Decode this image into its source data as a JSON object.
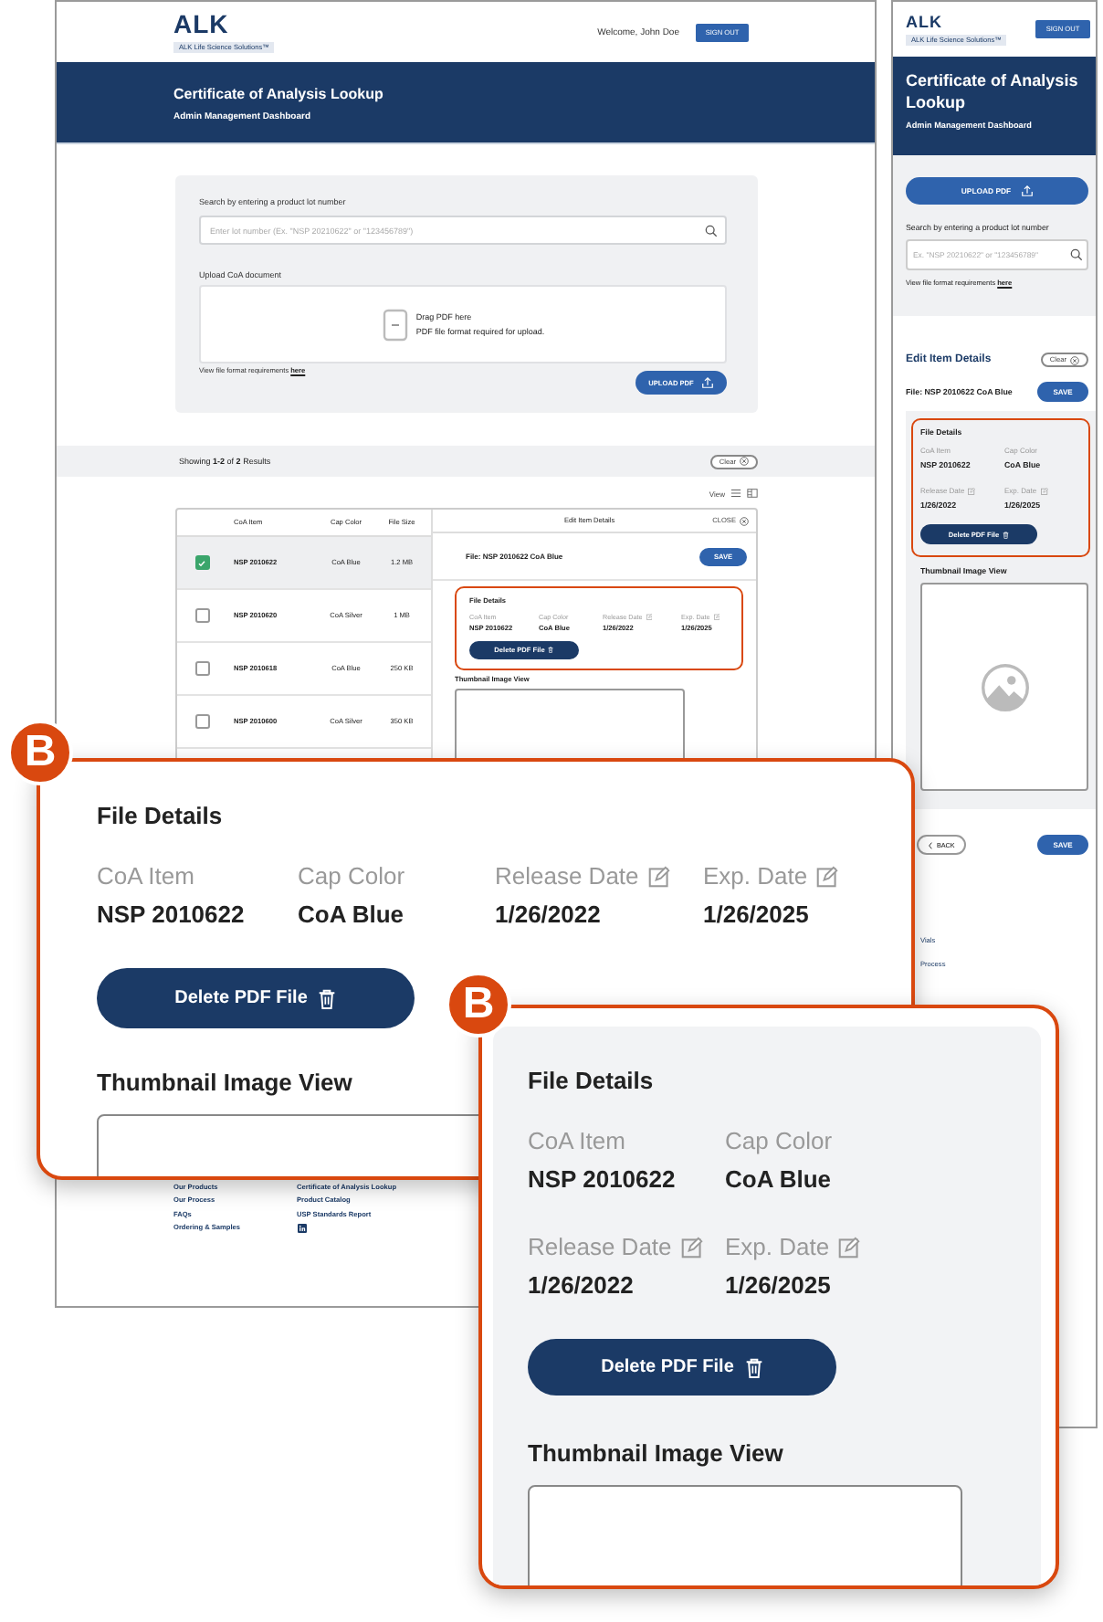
{
  "desktop": {
    "header": {
      "logo": "ALK",
      "tagline": "ALK Life Science Solutions™",
      "welcome": "Welcome, John Doe",
      "sign_out": "SIGN OUT"
    },
    "banner": {
      "title": "Certificate of Analysis Lookup",
      "subtitle": "Admin Management Dashboard"
    },
    "search": {
      "label": "Search by entering a product lot number",
      "placeholder": "Enter lot number (Ex. \"NSP 20210622\" or \"123456789\")"
    },
    "upload": {
      "label": "Upload CoA document",
      "drop_title": "Drag PDF here",
      "drop_hint": "PDF file format required for upload.",
      "requirements": "View file format requirements",
      "requirements_link": "here",
      "button": "UPLOAD PDF"
    },
    "results": {
      "summary": "Showing **1-2** of **2** Results",
      "clear": "Clear"
    },
    "view": {
      "label": "View"
    },
    "table": {
      "columns": [
        "CoA Item",
        "Cap Color",
        "File Size"
      ],
      "rows": [
        {
          "item": "NSP 2010622",
          "cap_color": "CoA Blue",
          "size": "1.2 MB",
          "checked": true,
          "selected": true
        },
        {
          "item": "NSP 2010620",
          "cap_color": "CoA Silver",
          "size": "1 MB",
          "checked": false,
          "selected": false
        },
        {
          "item": "NSP 2010618",
          "cap_color": "CoA Blue",
          "size": "250 KB",
          "checked": false,
          "selected": false
        },
        {
          "item": "NSP 2010600",
          "cap_color": "CoA Silver",
          "size": "350 KB",
          "checked": false,
          "selected": false
        }
      ]
    },
    "editor": {
      "title": "Edit Item Details",
      "close": "CLOSE",
      "file": "File: NSP 2010622 CoA Blue",
      "save": "SAVE",
      "details": {
        "title": "File Details",
        "fields": [
          {
            "label": "CoA Item",
            "value": "NSP 2010622",
            "editable": false
          },
          {
            "label": "Cap Color",
            "value": "CoA Blue",
            "editable": false
          },
          {
            "label": "Release Date",
            "value": "1/26/2022",
            "editable": true
          },
          {
            "label": "Exp. Date",
            "value": "1/26/2025",
            "editable": true
          }
        ],
        "delete": "Delete PDF File"
      },
      "thumbnail_label": "Thumbnail Image View"
    },
    "footer": {
      "columns": [
        [
          "Our Products",
          "Our Process",
          "FAQs",
          "Ordering & Samples"
        ],
        [
          "Certificate of Analysis Lookup",
          "Product Catalog",
          "USP Standards Report"
        ]
      ]
    }
  },
  "mobile": {
    "header": {
      "logo": "ALK",
      "tagline": "ALK Life Science Solutions™",
      "sign_out": "SIGN OUT"
    },
    "banner": {
      "title": "Certificate of Analysis Lookup",
      "subtitle": "Admin Management Dashboard"
    },
    "upload_button": "UPLOAD PDF",
    "search": {
      "label": "Search by entering a product lot number",
      "placeholder": "Ex. \"NSP 20210622\" or \"123456789\"",
      "requirements": "View file format requirements",
      "requirements_link": "here"
    },
    "editor": {
      "title": "Edit Item Details",
      "clear": "Clear",
      "file": "File: NSP 2010622 CoA Blue",
      "save": "SAVE",
      "details": {
        "title": "File Details",
        "fields": [
          {
            "label": "CoA Item",
            "value": "NSP 2010622",
            "editable": false
          },
          {
            "label": "Cap Color",
            "value": "CoA Blue",
            "editable": false
          },
          {
            "label": "Release Date",
            "value": "1/26/2022",
            "editable": true
          },
          {
            "label": "Exp. Date",
            "value": "1/26/2025",
            "editable": true
          }
        ],
        "delete": "Delete PDF File"
      },
      "thumbnail_label": "Thumbnail Image View"
    },
    "back": "BACK",
    "save": "SAVE",
    "footer_fragments": [
      "Vials",
      "Process"
    ]
  },
  "callouts": [
    {
      "badge": "B",
      "kind": "row",
      "details": {
        "title": "File Details",
        "fields": [
          {
            "label": "CoA Item",
            "value": "NSP 2010622",
            "editable": false
          },
          {
            "label": "Cap Color",
            "value": "CoA Blue",
            "editable": false
          },
          {
            "label": "Release Date",
            "value": "1/26/2022",
            "editable": true
          },
          {
            "label": "Exp. Date",
            "value": "1/26/2025",
            "editable": true
          }
        ],
        "delete": "Delete PDF File"
      },
      "thumbnail_label": "Thumbnail Image View"
    },
    {
      "badge": "B",
      "kind": "grid",
      "details": {
        "title": "File Details",
        "fields": [
          {
            "label": "CoA Item",
            "value": "NSP 2010622",
            "editable": false
          },
          {
            "label": "Cap Color",
            "value": "CoA Blue",
            "editable": false
          },
          {
            "label": "Release Date",
            "value": "1/26/2022",
            "editable": true
          },
          {
            "label": "Exp. Date",
            "value": "1/26/2025",
            "editable": true
          }
        ],
        "delete": "Delete PDF File"
      },
      "thumbnail_label": "Thumbnail Image View"
    }
  ]
}
